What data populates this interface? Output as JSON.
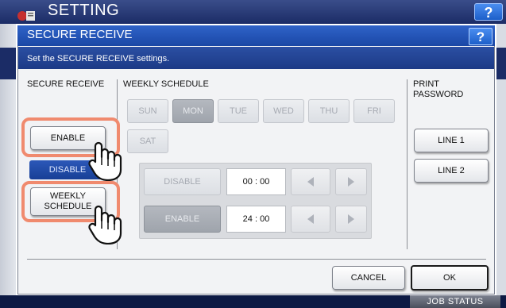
{
  "app": {
    "title": "SETTING",
    "help_label": "?",
    "job_status": "JOB STATUS"
  },
  "dialog": {
    "title": "SECURE RECEIVE",
    "help_label": "?",
    "message": "Set the SECURE RECEIVE settings.",
    "secure_receive": {
      "heading": "SECURE RECEIVE",
      "enable_label": "ENABLE",
      "disable_label": "DISABLE",
      "weekly_schedule_label": "WEEKLY\nSCHEDULE"
    },
    "weekly_schedule": {
      "heading": "WEEKLY SCHEDULE",
      "days": [
        "SUN",
        "MON",
        "TUE",
        "WED",
        "THU",
        "FRI",
        "SAT"
      ],
      "selected_day": "MON",
      "disable_label": "DISABLE",
      "disable_time": "00 : 00",
      "enable_label": "ENABLE",
      "enable_time": "24 : 00"
    },
    "print_password": {
      "heading": "PRINT\nPASSWORD",
      "line1_label": "LINE 1",
      "line2_label": "LINE 2"
    },
    "footer": {
      "cancel_label": "CANCEL",
      "ok_label": "OK"
    }
  },
  "colors": {
    "dialog_title": "#2f63c8",
    "message_bar": "#1c3a86",
    "highlight_ring": "#f08a6e"
  }
}
